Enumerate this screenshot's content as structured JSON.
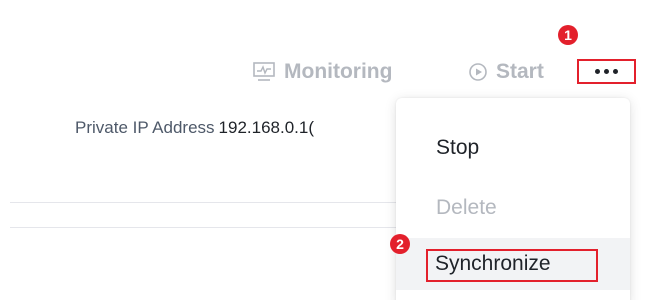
{
  "toolbar": {
    "monitoring_label": "Monitoring",
    "start_label": "Start",
    "monitoring_icon": "monitor-chart-icon",
    "start_icon": "play-circle-icon",
    "more_icon": "ellipsis-icon"
  },
  "annotations": {
    "step_1": "1",
    "step_2": "2",
    "highlight_color": "#e3202c"
  },
  "info": {
    "private_ip_label": "Private IP Address",
    "private_ip_value": "192.168.0.1("
  },
  "menu": {
    "items": [
      {
        "label": "Stop",
        "enabled": true
      },
      {
        "label": "Delete",
        "enabled": false
      },
      {
        "label": "Synchronize",
        "enabled": true
      }
    ]
  },
  "colors": {
    "text_primary": "#1f2329",
    "text_disabled": "#b4b8bf",
    "hover_bg": "#f2f3f5"
  }
}
